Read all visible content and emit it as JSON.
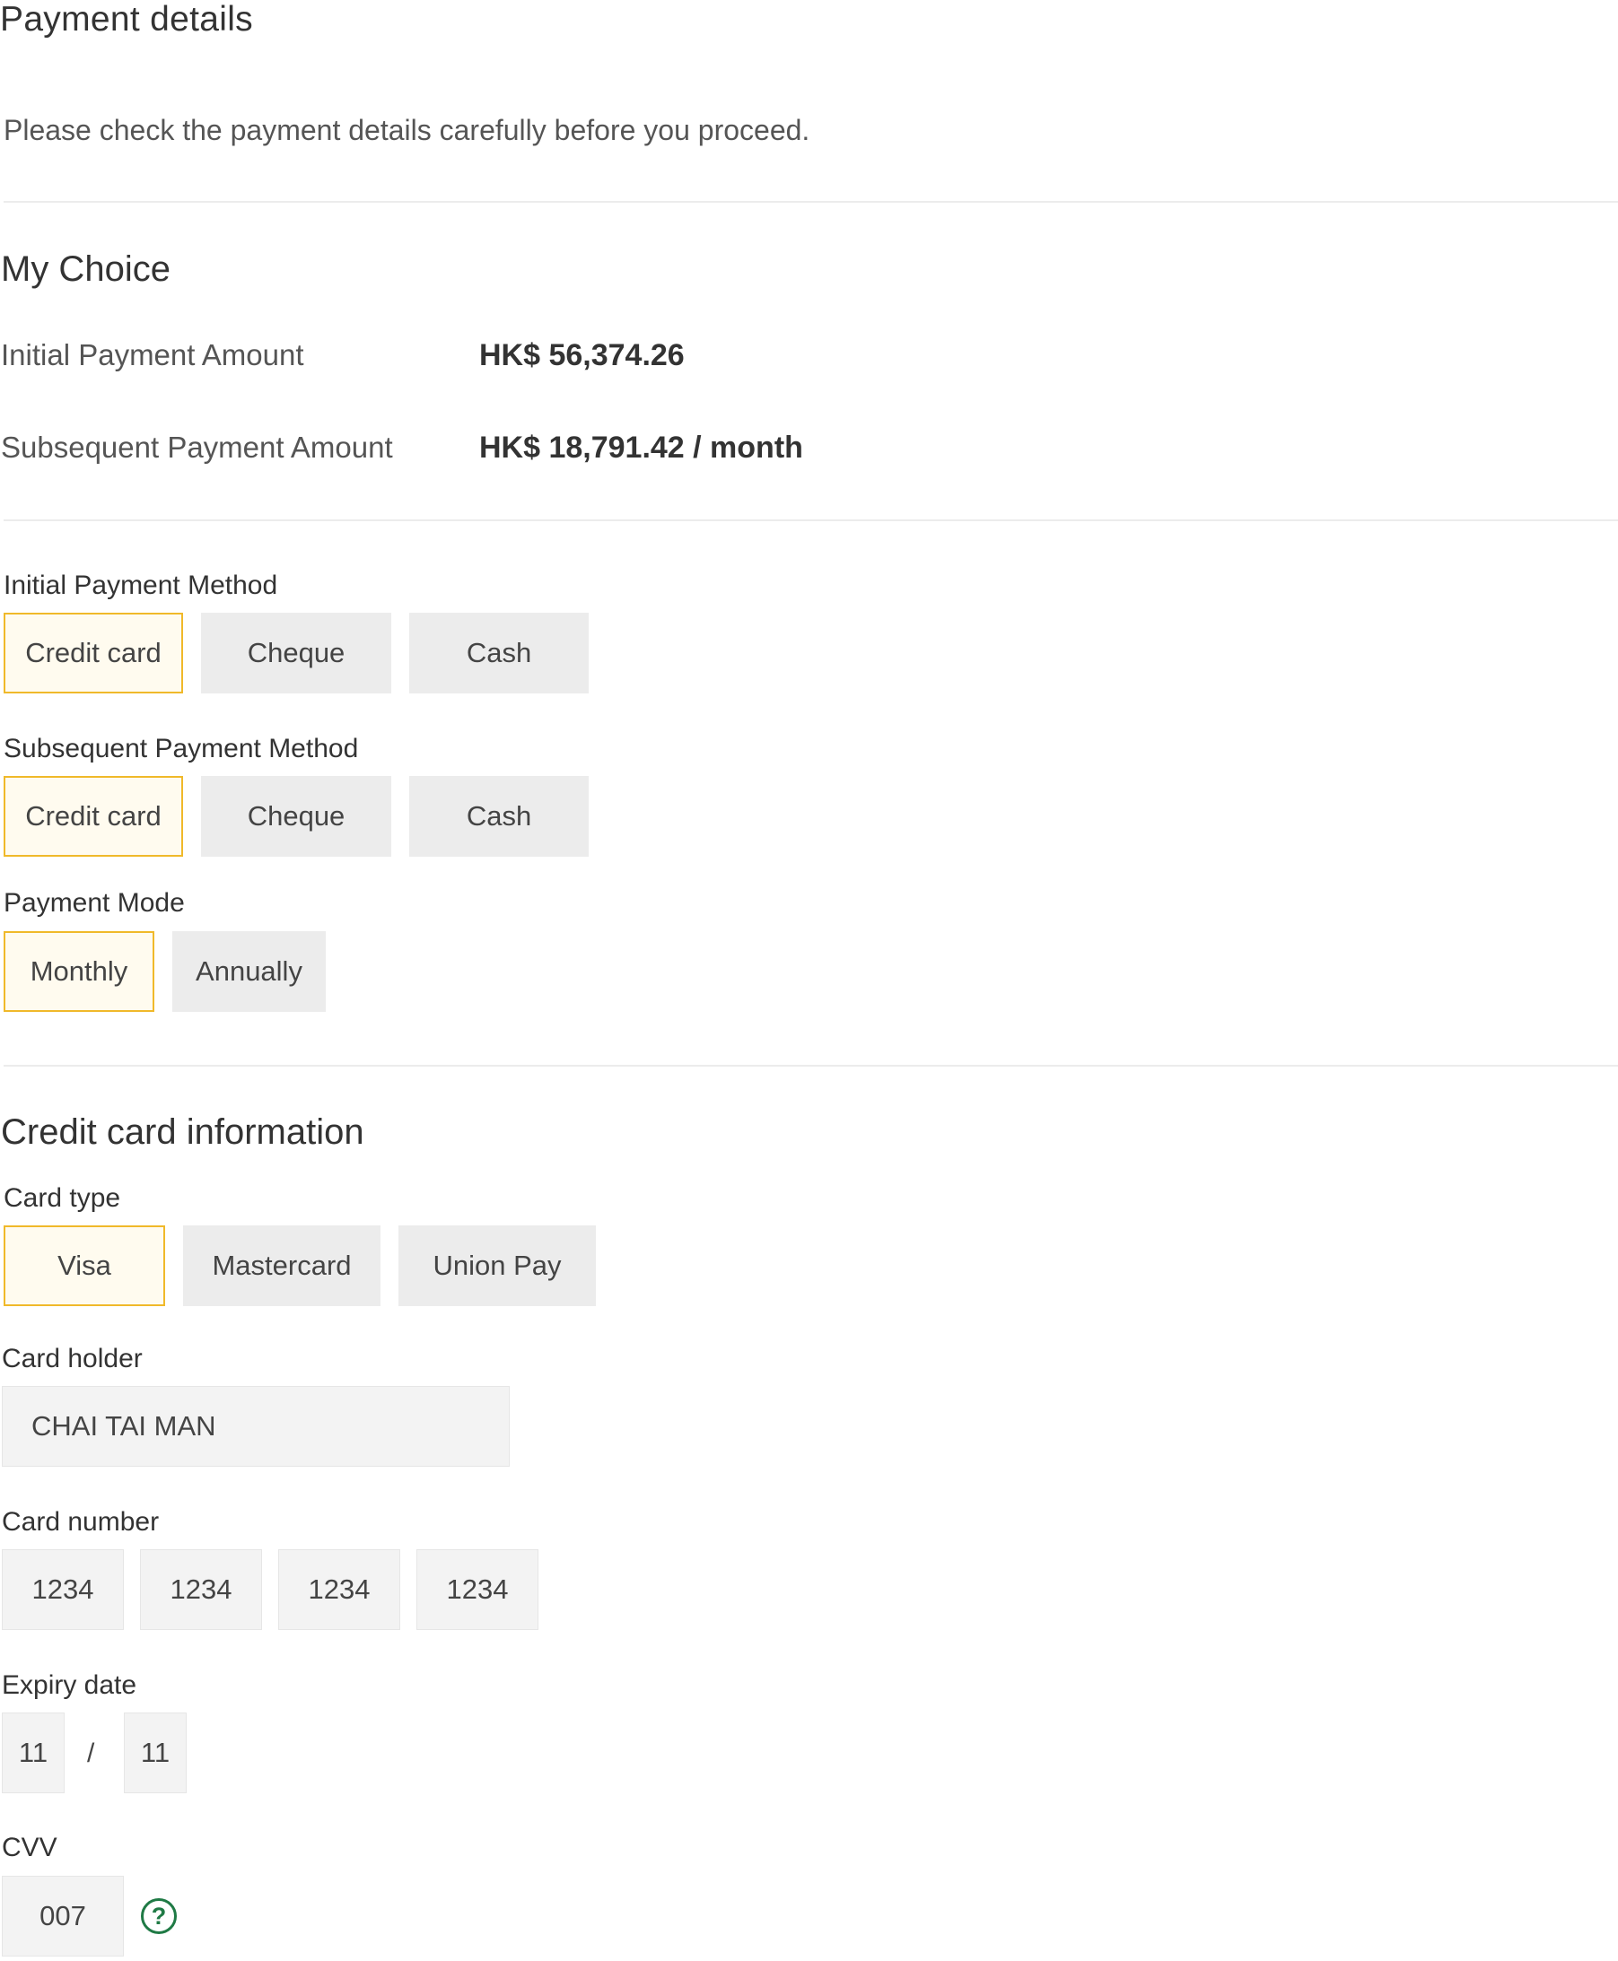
{
  "page": {
    "title": "Payment details",
    "intro": "Please check the payment details carefully before you proceed."
  },
  "my_choice": {
    "heading": "My Choice",
    "rows": [
      {
        "label": "Initial Payment Amount",
        "value": "HK$ 56,374.26"
      },
      {
        "label": "Subsequent Payment Amount",
        "value": "HK$ 18,791.42 / month"
      }
    ]
  },
  "initial_method": {
    "label": "Initial Payment Method",
    "options": [
      "Credit card",
      "Cheque",
      "Cash"
    ],
    "selected": "Credit card"
  },
  "subsequent_method": {
    "label": "Subsequent Payment Method",
    "options": [
      "Credit card",
      "Cheque",
      "Cash"
    ],
    "selected": "Credit card"
  },
  "payment_mode": {
    "label": "Payment Mode",
    "options": [
      "Monthly",
      "Annually"
    ],
    "selected": "Monthly"
  },
  "credit_card": {
    "heading": "Credit card information",
    "card_type": {
      "label": "Card type",
      "options": [
        "Visa",
        "Mastercard",
        "Union Pay"
      ],
      "selected": "Visa"
    },
    "card_holder": {
      "label": "Card holder",
      "value": "CHAI TAI MAN"
    },
    "card_number": {
      "label": "Card number",
      "groups": [
        "1234",
        "1234",
        "1234",
        "1234"
      ]
    },
    "expiry": {
      "label": "Expiry date",
      "month": "11",
      "separator": "/",
      "year": "11"
    },
    "cvv": {
      "label": "CVV",
      "value": "007",
      "help_icon": "question-circle-icon"
    }
  },
  "colors": {
    "selected_border": "#f0b92a",
    "selected_fill": "#fffbef",
    "option_fill": "#ececec",
    "help_icon": "#1f7a45"
  }
}
